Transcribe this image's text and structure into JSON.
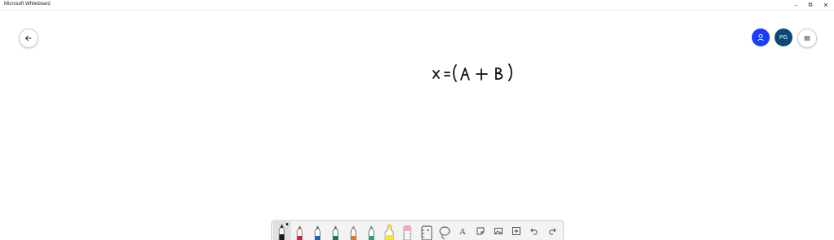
{
  "app": {
    "title": "Microsoft Whiteboard"
  },
  "window_controls": {
    "minimize": "–",
    "restore": "⧉",
    "close": "✕"
  },
  "header": {
    "back_icon": "arrow-left-icon",
    "share_icon": "person-icon",
    "avatar_initials": "PG",
    "menu_icon": "hamburger-icon",
    "accent_color": "#1a3cff",
    "avatar_color": "#0b4a74"
  },
  "canvas": {
    "ink_text": "x = (A + B)"
  },
  "toolbar": {
    "tools": [
      {
        "name": "black-pen",
        "color": "#1a1a1a"
      },
      {
        "name": "red-pen",
        "color": "#d4213d"
      },
      {
        "name": "blue-pen",
        "color": "#1565c0"
      },
      {
        "name": "green-pen",
        "color": "#1b7f3a"
      },
      {
        "name": "orange-pen",
        "color": "#e8731a"
      },
      {
        "name": "teal-pen",
        "color": "#2a9d8f"
      },
      {
        "name": "highlighter",
        "color": "#f5e52b"
      },
      {
        "name": "eraser",
        "color": "#f3a6c8"
      }
    ],
    "icons": [
      "ruler-icon",
      "lasso-icon",
      "text-icon",
      "note-icon",
      "image-icon",
      "insert-icon",
      "undo-icon",
      "redo-icon"
    ],
    "text_tool_glyph": "A"
  }
}
